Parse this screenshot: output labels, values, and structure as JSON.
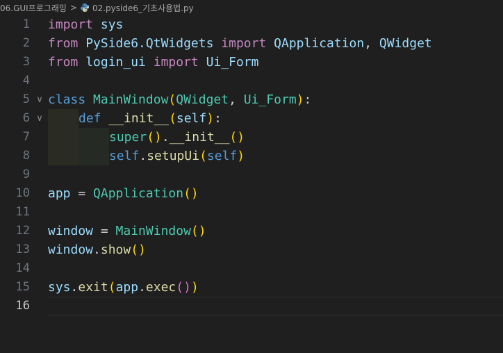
{
  "breadcrumb": {
    "folder": "06.GUI프로그래밍",
    "separator": ">",
    "file_icon": "python-file-icon",
    "file": "02.pyside6_기초사용법.py"
  },
  "lines": [
    {
      "n": "1",
      "tokens": [
        {
          "t": "import",
          "c": "kw"
        },
        {
          "t": " ",
          "c": "op"
        },
        {
          "t": "sys",
          "c": "id"
        }
      ]
    },
    {
      "n": "2",
      "tokens": [
        {
          "t": "from",
          "c": "kw"
        },
        {
          "t": " ",
          "c": "op"
        },
        {
          "t": "PySide6.QtWidgets",
          "c": "id"
        },
        {
          "t": " ",
          "c": "op"
        },
        {
          "t": "import",
          "c": "kw"
        },
        {
          "t": " ",
          "c": "op"
        },
        {
          "t": "QApplication",
          "c": "id"
        },
        {
          "t": ", ",
          "c": "op"
        },
        {
          "t": "QWidget",
          "c": "id"
        }
      ]
    },
    {
      "n": "3",
      "tokens": [
        {
          "t": "from",
          "c": "kw"
        },
        {
          "t": " ",
          "c": "op"
        },
        {
          "t": "login_ui",
          "c": "id"
        },
        {
          "t": " ",
          "c": "op"
        },
        {
          "t": "import",
          "c": "kw"
        },
        {
          "t": " ",
          "c": "op"
        },
        {
          "t": "Ui_Form",
          "c": "id"
        }
      ]
    },
    {
      "n": "4",
      "tokens": []
    },
    {
      "n": "5",
      "fold": true,
      "tokens": [
        {
          "t": "class",
          "c": "kwb"
        },
        {
          "t": " ",
          "c": "op"
        },
        {
          "t": "MainWindow",
          "c": "cls"
        },
        {
          "t": "(",
          "c": "b1"
        },
        {
          "t": "QWidget",
          "c": "cls"
        },
        {
          "t": ", ",
          "c": "op"
        },
        {
          "t": "Ui_Form",
          "c": "cls"
        },
        {
          "t": ")",
          "c": "b1"
        },
        {
          "t": ":",
          "c": "op"
        }
      ]
    },
    {
      "n": "6",
      "fold": true,
      "indent": 1,
      "tokens": [
        {
          "t": "def",
          "c": "kwb"
        },
        {
          "t": " ",
          "c": "op"
        },
        {
          "t": "__init__",
          "c": "fn"
        },
        {
          "t": "(",
          "c": "b1"
        },
        {
          "t": "self",
          "c": "id"
        },
        {
          "t": ")",
          "c": "b1"
        },
        {
          "t": ":",
          "c": "op"
        }
      ]
    },
    {
      "n": "7",
      "indent": 2,
      "tokens": [
        {
          "t": "super",
          "c": "cls"
        },
        {
          "t": "(",
          "c": "b1"
        },
        {
          "t": ")",
          "c": "b1"
        },
        {
          "t": ".",
          "c": "op"
        },
        {
          "t": "__init__",
          "c": "fn"
        },
        {
          "t": "(",
          "c": "b1"
        },
        {
          "t": ")",
          "c": "b1"
        }
      ]
    },
    {
      "n": "8",
      "indent": 2,
      "tokens": [
        {
          "t": "self",
          "c": "kwb"
        },
        {
          "t": ".",
          "c": "op"
        },
        {
          "t": "setupUi",
          "c": "fn"
        },
        {
          "t": "(",
          "c": "b1"
        },
        {
          "t": "self",
          "c": "kwb"
        },
        {
          "t": ")",
          "c": "b1"
        }
      ]
    },
    {
      "n": "9",
      "tokens": []
    },
    {
      "n": "10",
      "tokens": [
        {
          "t": "app",
          "c": "id"
        },
        {
          "t": " = ",
          "c": "op"
        },
        {
          "t": "QApplication",
          "c": "cls"
        },
        {
          "t": "(",
          "c": "b1"
        },
        {
          "t": ")",
          "c": "b1"
        }
      ]
    },
    {
      "n": "11",
      "tokens": []
    },
    {
      "n": "12",
      "tokens": [
        {
          "t": "window",
          "c": "id"
        },
        {
          "t": " = ",
          "c": "op"
        },
        {
          "t": "MainWindow",
          "c": "cls"
        },
        {
          "t": "(",
          "c": "b1"
        },
        {
          "t": ")",
          "c": "b1"
        }
      ]
    },
    {
      "n": "13",
      "tokens": [
        {
          "t": "window",
          "c": "id"
        },
        {
          "t": ".",
          "c": "op"
        },
        {
          "t": "show",
          "c": "fn"
        },
        {
          "t": "(",
          "c": "b1"
        },
        {
          "t": ")",
          "c": "b1"
        }
      ]
    },
    {
      "n": "14",
      "tokens": []
    },
    {
      "n": "15",
      "tokens": [
        {
          "t": "sys",
          "c": "id"
        },
        {
          "t": ".",
          "c": "op"
        },
        {
          "t": "exit",
          "c": "fn"
        },
        {
          "t": "(",
          "c": "b1"
        },
        {
          "t": "app",
          "c": "id"
        },
        {
          "t": ".",
          "c": "op"
        },
        {
          "t": "exec",
          "c": "fn"
        },
        {
          "t": "(",
          "c": "b2"
        },
        {
          "t": ")",
          "c": "b2"
        },
        {
          "t": ")",
          "c": "b1"
        }
      ]
    },
    {
      "n": "16",
      "current": true,
      "tokens": []
    }
  ],
  "colors": {
    "background": "#1f1f1f",
    "keyword_control": "#c586c0",
    "keyword": "#569cd6",
    "variable": "#9cdcfe",
    "function": "#dcdcaa",
    "class": "#4ec9b0",
    "bracket_level1": "#ffd700",
    "bracket_level2": "#da70d6",
    "line_number": "#6e7681"
  }
}
